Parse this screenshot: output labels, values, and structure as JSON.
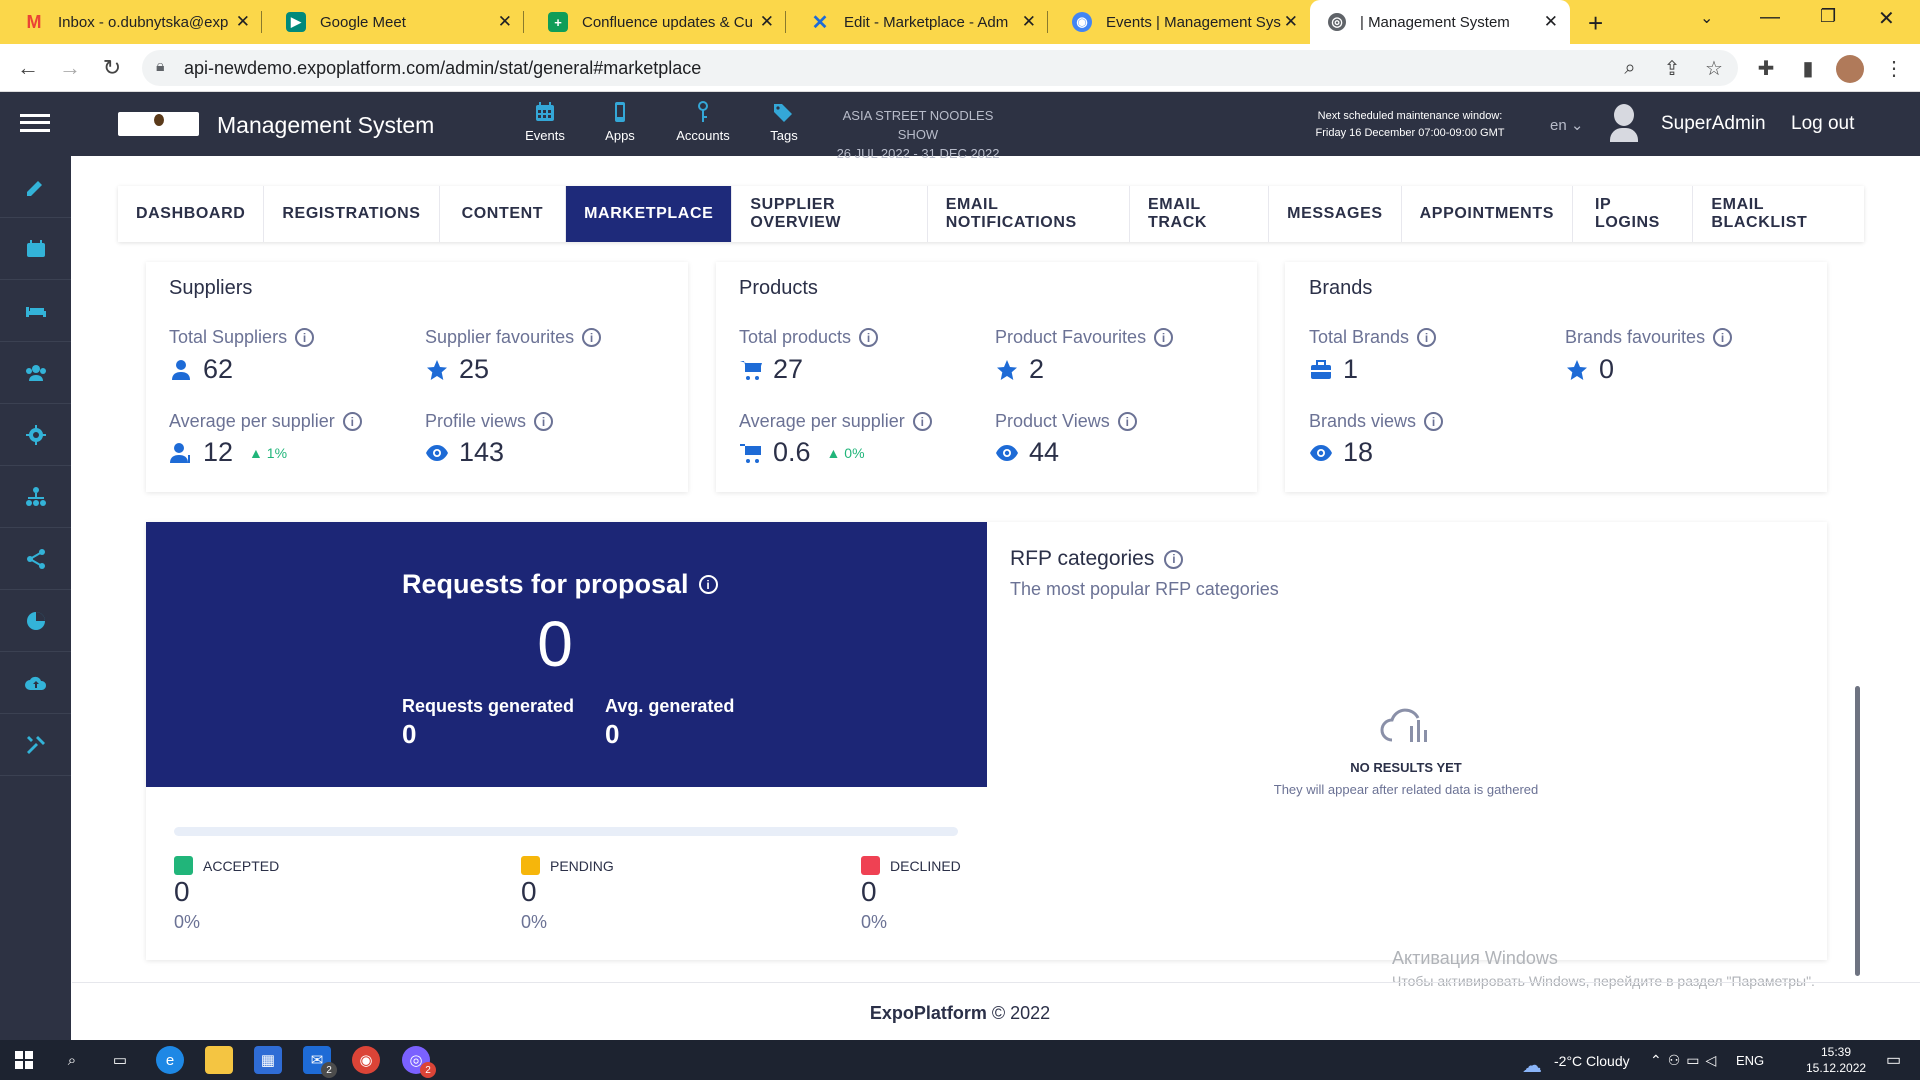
{
  "browser": {
    "tabs": [
      {
        "title": "Inbox - o.dubnytska@exp",
        "icon": "gmail-icon",
        "color": "#ea4335"
      },
      {
        "title": "Google Meet",
        "icon": "meet-icon",
        "color": "#00897b"
      },
      {
        "title": "Confluence updates & Cu",
        "icon": "sheets-icon",
        "color": "#0f9d58"
      },
      {
        "title": "Edit - Marketplace - Adm",
        "icon": "butterfly-icon",
        "color": "#1e6bd6"
      },
      {
        "title": "Events | Management Sys",
        "icon": "events-icon",
        "color": "#4285f4"
      },
      {
        "title": "| Management System",
        "icon": "globe-icon",
        "color": "#5f6368"
      }
    ],
    "url": "api-newdemo.expoplatform.com/admin/stat/general#marketplace"
  },
  "header": {
    "app_title": "Management System",
    "nav": [
      {
        "label": "Events",
        "icon": "calendar-icon"
      },
      {
        "label": "Apps",
        "icon": "phone-icon"
      },
      {
        "label": "Accounts",
        "icon": "key-icon"
      },
      {
        "label": "Tags",
        "icon": "tags-icon"
      }
    ],
    "event_name": "ASIA STREET NOODLES SHOW",
    "event_dates": "26 JUL 2022 - 31 DEC 2022",
    "maintenance_line1": "Next scheduled maintenance window:",
    "maintenance_line2": "Friday 16 December 07:00-09:00 GMT",
    "language": "en",
    "user": "SuperAdmin",
    "logout": "Log out"
  },
  "tabs": [
    {
      "label": "DASHBOARD",
      "active": false
    },
    {
      "label": "REGISTRATIONS",
      "active": false
    },
    {
      "label": "CONTENT",
      "active": false
    },
    {
      "label": "MARKETPLACE",
      "active": true
    },
    {
      "label": "SUPPLIER OVERVIEW",
      "active": false
    },
    {
      "label": "EMAIL NOTIFICATIONS",
      "active": false
    },
    {
      "label": "EMAIL TRACK",
      "active": false
    },
    {
      "label": "MESSAGES",
      "active": false
    },
    {
      "label": "APPOINTMENTS",
      "active": false
    },
    {
      "label": "IP LOGINS",
      "active": false
    },
    {
      "label": "EMAIL BLACKLIST",
      "active": false
    }
  ],
  "suppliers": {
    "title": "Suppliers",
    "total_label": "Total Suppliers",
    "total_value": "62",
    "fav_label": "Supplier favourites",
    "fav_value": "25",
    "avg_label": "Average per supplier",
    "avg_value": "12",
    "avg_trend": "1%",
    "views_label": "Profile views",
    "views_value": "143"
  },
  "products": {
    "title": "Products",
    "total_label": "Total products",
    "total_value": "27",
    "fav_label": "Product Favourites",
    "fav_value": "2",
    "avg_label": "Average per supplier",
    "avg_value": "0.6",
    "avg_trend": "0%",
    "views_label": "Product Views",
    "views_value": "44"
  },
  "brands": {
    "title": "Brands",
    "total_label": "Total Brands",
    "total_value": "1",
    "fav_label": "Brands favourites",
    "fav_value": "0",
    "views_label": "Brands views",
    "views_value": "18"
  },
  "rfp": {
    "title": "Requests for proposal",
    "total": "0",
    "generated_label": "Requests generated",
    "generated_value": "0",
    "avg_label": "Avg. generated",
    "avg_value": "0",
    "legend": [
      {
        "label": "ACCEPTED",
        "value": "0",
        "pct": "0%",
        "color": "#21b57a"
      },
      {
        "label": "PENDING",
        "value": "0",
        "pct": "0%",
        "color": "#f6b60b"
      },
      {
        "label": "DECLINED",
        "value": "0",
        "pct": "0%",
        "color": "#ef4153"
      }
    ]
  },
  "rfp_categories": {
    "title": "RFP categories",
    "subtitle": "The most popular RFP categories",
    "empty_title": "NO RESULTS YET",
    "empty_sub": "They will appear after related data is gathered"
  },
  "watermark": {
    "line1": "Активация Windows",
    "line2": "Чтобы активировать Windows, перейдите в раздел \"Параметры\"."
  },
  "footer": {
    "brand": "ExpoPlatform",
    "copy": "© 2022"
  },
  "taskbar": {
    "weather": "-2°C  Cloudy",
    "lang": "ENG",
    "time": "15:39",
    "date": "15.12.2022",
    "mail_badge": "2",
    "chat_badge": "2"
  },
  "colors": {
    "accent": "#1c2676",
    "header": "#2d3243",
    "icon_blue": "#1e6bd6"
  }
}
